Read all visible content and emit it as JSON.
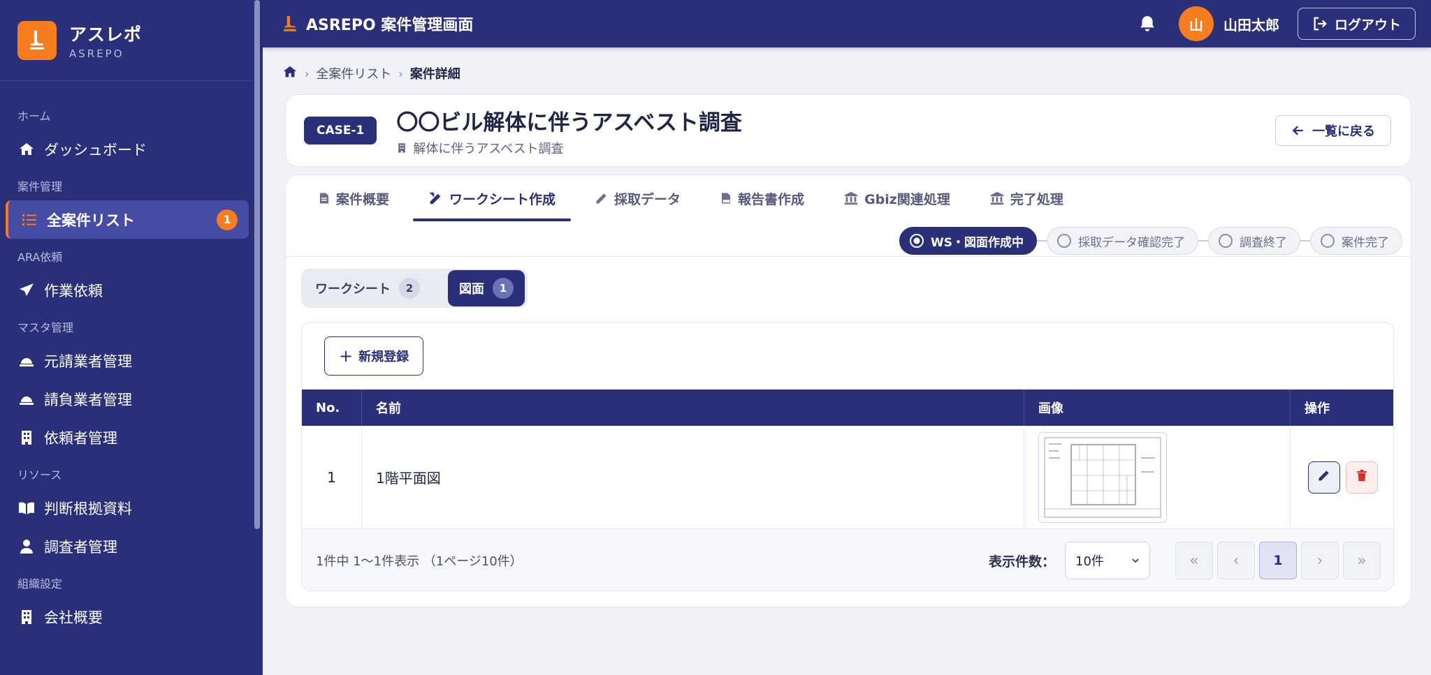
{
  "brand": {
    "name": "アスレポ",
    "sub": "ASREPO"
  },
  "sidebar": {
    "sections": [
      {
        "label": "ホーム"
      },
      {
        "label": "案件管理"
      },
      {
        "label": "ARA依頼"
      },
      {
        "label": "マスタ管理"
      },
      {
        "label": "リソース"
      },
      {
        "label": "組織設定"
      }
    ],
    "items": [
      {
        "label": "ダッシュボード"
      },
      {
        "label": "全案件リスト",
        "badge": "1"
      },
      {
        "label": "作業依頼"
      },
      {
        "label": "元請業者管理"
      },
      {
        "label": "請負業者管理"
      },
      {
        "label": "依頼者管理"
      },
      {
        "label": "判断根拠資料"
      },
      {
        "label": "調査者管理"
      },
      {
        "label": "会社概要"
      }
    ]
  },
  "header": {
    "title": "ASREPO 案件管理画面",
    "avatar_initial": "山",
    "user_name": "山田太郎",
    "logout_label": "ログアウト"
  },
  "breadcrumb": {
    "items": [
      "全案件リスト",
      "案件詳細"
    ]
  },
  "case": {
    "id": "CASE-1",
    "title": "〇〇ビル解体に伴うアスベスト調査",
    "subtitle": "解体に伴うアスベスト調査",
    "back_label": "一覧に戻る"
  },
  "tabs": [
    {
      "label": "案件概要"
    },
    {
      "label": "ワークシート作成",
      "active": true
    },
    {
      "label": "採取データ"
    },
    {
      "label": "報告書作成"
    },
    {
      "label": "Gbiz関連処理"
    },
    {
      "label": "完了処理"
    }
  ],
  "status_steps": [
    {
      "label": "WS・図面作成中",
      "active": true
    },
    {
      "label": "採取データ確認完了"
    },
    {
      "label": "調査終了"
    },
    {
      "label": "案件完了"
    }
  ],
  "sub_tabs": [
    {
      "label": "ワークシート",
      "count": "2"
    },
    {
      "label": "図面",
      "count": "1",
      "active": true
    }
  ],
  "new_button_label": "新規登録",
  "table": {
    "headers": {
      "no": "No.",
      "name": "名前",
      "image": "画像",
      "ops": "操作"
    },
    "rows": [
      {
        "no": "1",
        "name": "1階平面図"
      }
    ]
  },
  "footer": {
    "info": "1件中 1〜1件表示 （1ページ10件）",
    "per_page_label": "表示件数：",
    "per_page_value": "10件",
    "current_page": "1"
  },
  "colors": {
    "primary": "#2a2f7a",
    "accent": "#f57c1f",
    "danger": "#d63030"
  }
}
